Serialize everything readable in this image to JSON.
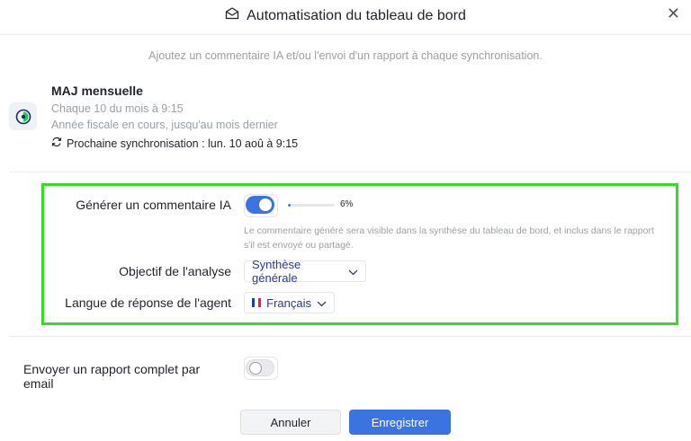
{
  "dialog": {
    "title": "Automatisation du tableau de bord",
    "close_glyph": "✕",
    "subtitle": "Ajoutez un commentaire IA et/ou l'envoi d'un rapport à chaque synchronisation."
  },
  "schedule": {
    "name": "MAJ mensuelle",
    "frequency": "Chaque 10 du mois à 9:15",
    "period": "Année fiscale en cours, jusqu'au mois dernier",
    "next_sync": "Prochaine synchronisation : lun. 10 aoû à 9:15",
    "icon": "schedule-icon"
  },
  "ai_comment": {
    "label": "Générer un commentaire IA",
    "enabled": true,
    "progress_percent": 6,
    "progress_text": "6%",
    "hint_line1": "Le commentaire généré sera visible dans la synthèse du tableau de bord, et inclus dans le rapport",
    "hint_line2": "s'il est envoyé ou partagé.",
    "objective_label": "Objectif de l'analyse",
    "objective_value": "Synthèse générale",
    "language_label": "Langue de réponse de l'agent",
    "language_value": "Français"
  },
  "email_report": {
    "label": "Envoyer un rapport complet par email",
    "enabled": false
  },
  "buttons": {
    "cancel": "Annuler",
    "save": "Enregistrer"
  },
  "colors": {
    "accent": "#3b73e0",
    "highlight": "#33dd22",
    "muted_text": "#9aa0a6"
  }
}
